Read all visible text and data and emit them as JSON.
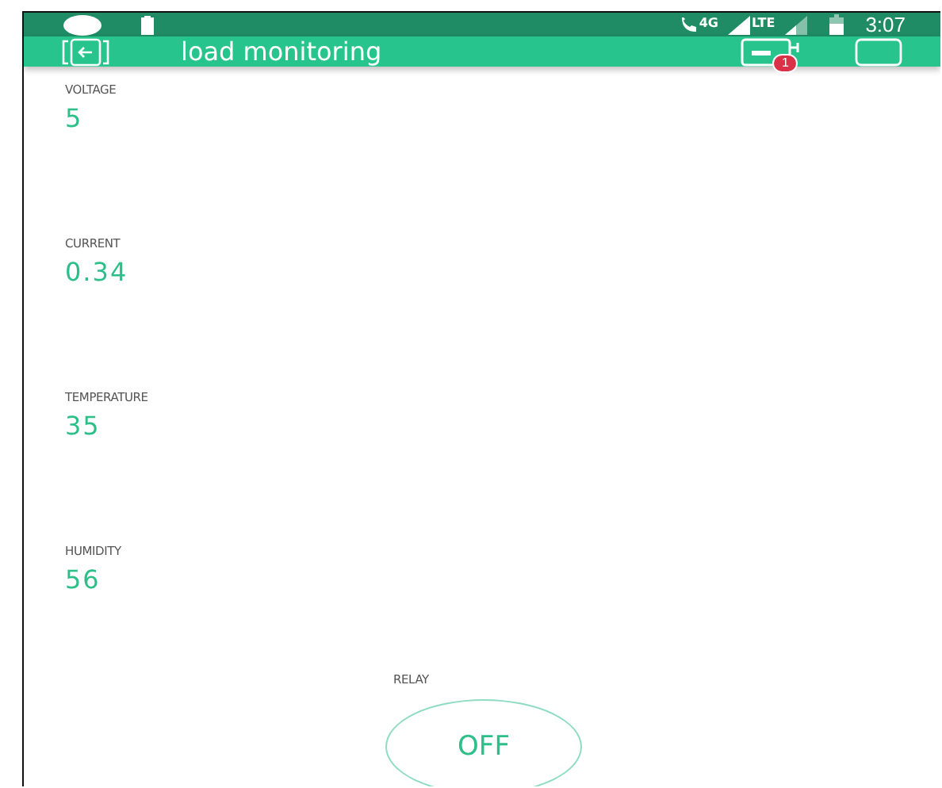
{
  "status_bar": {
    "network": "4G",
    "network_2": "LTE",
    "time": "3:07"
  },
  "app_bar": {
    "title": "load monitoring",
    "badge": "1"
  },
  "displays": [
    {
      "label": "VOLTAGE",
      "value": "5"
    },
    {
      "label": "CURRENT",
      "value": "0.34"
    },
    {
      "label": "TEMPERATURE",
      "value": "35"
    },
    {
      "label": "HUMIDITY",
      "value": "56"
    }
  ],
  "relay": {
    "label": "RELAY",
    "text": "OFF",
    "on": false
  }
}
